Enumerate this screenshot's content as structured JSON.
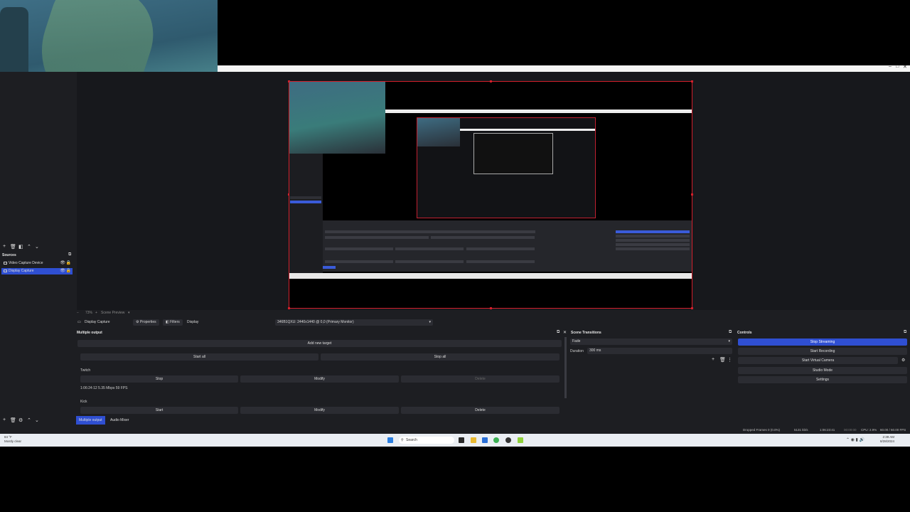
{
  "window": {
    "controls": [
      "–",
      "□",
      "✕"
    ]
  },
  "zoom_bar": {
    "zoom": "73%",
    "canvas": "Scene Preview"
  },
  "sources": {
    "header": "Sources",
    "items": [
      {
        "name": "Video Capture Device",
        "selected": false
      },
      {
        "name": "Display Capture",
        "selected": true
      }
    ]
  },
  "properties_bar": {
    "source_name": "Display Capture",
    "properties_label": "Properties",
    "filters_label": "Filters",
    "display_label": "Display",
    "display_value": "346B1QXU: 2440x1440 @ 0,0 (Primary Monitor)"
  },
  "multiple_output": {
    "title": "Multiple output",
    "add_target": "Add new target",
    "start_all": "Start all",
    "stop_all": "Stop all",
    "targets": [
      {
        "name": "Twitch",
        "primary": "Stop",
        "modify": "Modify",
        "delete": "Delete",
        "stats": "1:06:24:12  5.35 Mbps  59 FPS",
        "delete_disabled": true
      },
      {
        "name": "Kick",
        "primary": "Start",
        "modify": "Modify",
        "delete": "Delete",
        "stats": "",
        "delete_disabled": false
      }
    ]
  },
  "scene_transitions": {
    "title": "Scene Transitions",
    "transition": "Fade",
    "duration_label": "Duration",
    "duration_value": "300 ms"
  },
  "controls": {
    "title": "Controls",
    "stop_streaming": "Stop Streaming",
    "start_recording": "Start Recording",
    "start_virtual_camera": "Start Virtual Camera",
    "studio_mode": "Studio Mode",
    "settings": "Settings"
  },
  "bottom_tabs": [
    "Multiple output",
    "Audio Mixer"
  ],
  "status": {
    "dropped_frames": "Dropped Frames 0 (0.0%)",
    "bitrate": "5131 kb/s",
    "stream_time": "1:06:23:41",
    "record_time": "00:00:00",
    "cpu": "CPU: 2.9%",
    "fps": "60.00 / 60.00 FPS"
  },
  "taskbar": {
    "search_placeholder": "Search",
    "weather_temp": "84 °F",
    "weather_desc": "Mostly clear",
    "time": "2:39 AM",
    "date": "8/28/2024"
  },
  "colors": {
    "accent": "#2f4fd2",
    "preview_border": "#d21f2b",
    "panel_bg": "#1d1e22"
  }
}
